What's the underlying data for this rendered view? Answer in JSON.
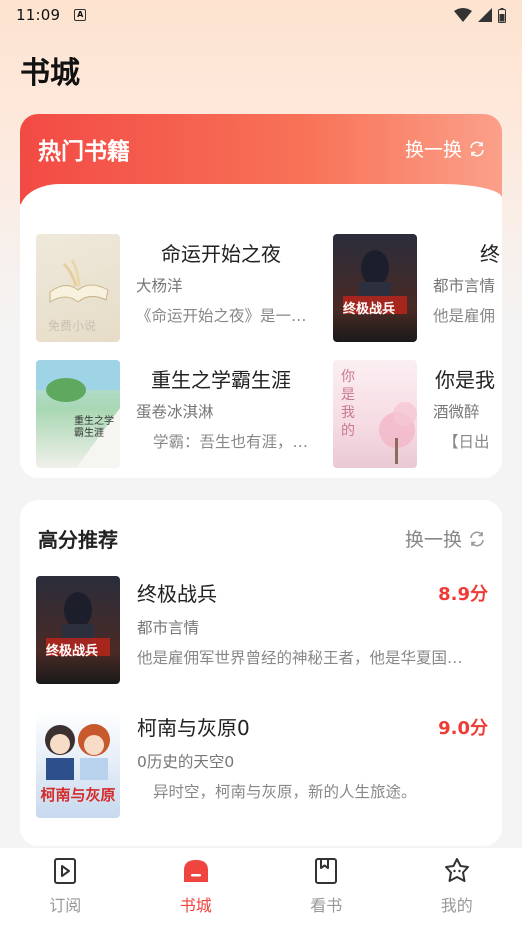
{
  "status_bar": {
    "time": "11:09",
    "notification_icon": "A"
  },
  "page_title": "书城",
  "hot_section": {
    "title": "热门书籍",
    "refresh_label": "换一换",
    "books": [
      {
        "title": "命运开始之夜",
        "author": "大杨洋",
        "desc": "《命运开始之夜》是一…",
        "cover_text": "免费小说"
      },
      {
        "title": "终",
        "author": "都市言情",
        "desc": "他是雇佣",
        "cover_text": "终极战兵"
      },
      {
        "title": "重生之学霸生涯",
        "author": "蛋卷冰淇淋",
        "desc": "学霸：吾生也有涯，…",
        "cover_text": "重生之学霸生涯"
      },
      {
        "title": "你是我",
        "author": "酒微醉",
        "desc": "【日出",
        "cover_text": "你是我的"
      }
    ]
  },
  "rec_section": {
    "title": "高分推荐",
    "refresh_label": "换一换",
    "books": [
      {
        "title": "终极战兵",
        "author": "都市言情",
        "desc": "他是雇佣军世界曾经的神秘王者，他是华夏国…",
        "score": "8.9分",
        "cover_text": "终极战兵"
      },
      {
        "title": "柯南与灰原0",
        "author": "0历史的天空0",
        "desc": "异时空，柯南与灰原，新的人生旅途。",
        "score": "9.0分",
        "cover_text": "柯南与灰原"
      }
    ]
  },
  "bottom_nav": [
    {
      "label": "订阅",
      "icon": "subscribe-icon",
      "active": false
    },
    {
      "label": "书城",
      "icon": "bookstore-icon",
      "active": true
    },
    {
      "label": "看书",
      "icon": "read-book-icon",
      "active": false
    },
    {
      "label": "我的",
      "icon": "profile-icon",
      "active": false
    }
  ],
  "colors": {
    "accent": "#f0443e",
    "header_start": "#f24a44",
    "header_end": "#fba08a"
  }
}
